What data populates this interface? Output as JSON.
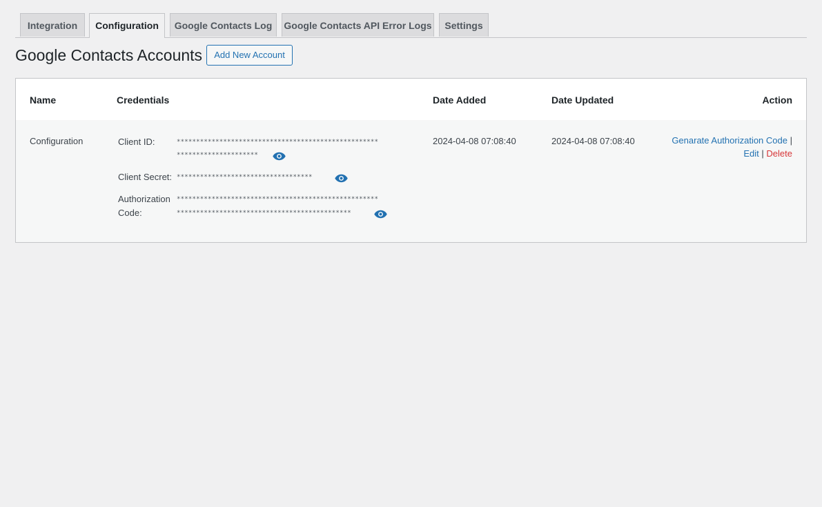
{
  "tabs": [
    {
      "label": "Integration",
      "active": false
    },
    {
      "label": "Configuration",
      "active": true
    },
    {
      "label": "Google Contacts Log",
      "active": false
    },
    {
      "label": "Google Contacts API Error Logs",
      "active": false
    },
    {
      "label": "Settings",
      "active": false
    }
  ],
  "page": {
    "title": "Google Contacts Accounts",
    "add_button": "Add New Account"
  },
  "table": {
    "headers": {
      "name": "Name",
      "credentials": "Credentials",
      "date_added": "Date Added",
      "date_updated": "Date Updated",
      "action": "Action"
    },
    "rows": [
      {
        "name": "Configuration",
        "credentials": {
          "client_id_label": "Client ID:",
          "client_id_line1": "****************************************************",
          "client_id_line2": "*********************",
          "client_secret_label": "Client Secret:",
          "client_secret_value": "***********************************",
          "auth_code_label_1": "Authorization",
          "auth_code_label_2": "Code:",
          "auth_code_line1": "****************************************************",
          "auth_code_line2": "*********************************************"
        },
        "date_added": "2024-04-08 07:08:40",
        "date_updated": "2024-04-08 07:08:40",
        "actions": {
          "generate": "Genarate Authorization Code",
          "edit": "Edit",
          "delete": "Delete",
          "separator": "|"
        }
      }
    ]
  },
  "colors": {
    "link": "#2271b1",
    "delete": "#d63638",
    "eye_icon": "#2271b1"
  },
  "icons": {
    "reveal": "eye-icon"
  }
}
